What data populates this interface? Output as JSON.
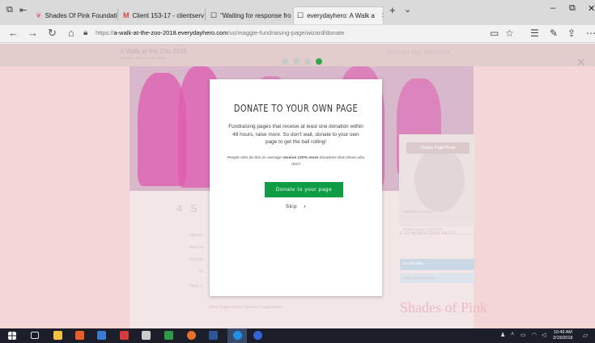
{
  "browser": {
    "tabs": [
      {
        "label": "Shades Of Pink Foundation",
        "icon": "pink-foundation-icon"
      },
      {
        "label": "Client 153-17 - clientservice",
        "icon": "gmail-icon"
      },
      {
        "label": "\"Waiting for response from",
        "icon": "page-icon"
      },
      {
        "label": "everydayhero: A Walk a",
        "icon": "page-icon",
        "active": true
      }
    ],
    "url_prefix": "https://",
    "url_domain": "a-walk-at-the-zoo-2018.everydayhero.com",
    "url_path": "/us/maggie-fundraising-page/wizard/donate"
  },
  "site": {
    "title": "A Walk at the Zoo 2018",
    "subtitle": "8 months ago • 30 Jan 2018",
    "header_links": "SEARCH    THE PATIENTS",
    "update_photo": "Update Page Photo",
    "fundraising_label": "E FUNDRAISING PAGE",
    "sidebar_rows": [
      "Support this Page",
      "Share to your Facebook",
      "Create team",
      "Invite existing team"
    ],
    "ghost_heading": "4 S",
    "ghost_lines": [
      "Upload",
      "Add exa",
      "Post an",
      "Dr",
      "Have a",
      "More Suggestions / Dismiss Suggestions"
    ],
    "logo_text": "Shades of Pink"
  },
  "wizard": {
    "steps": [
      false,
      false,
      false,
      true
    ]
  },
  "modal": {
    "title": "DONATE TO YOUR OWN PAGE",
    "body": "Fundraising pages that receive at least one donation within 48 hours, raise more. So don't wait, donate to your own page to get the ball rolling!",
    "note_pre": "People who do this on average",
    "note_bold": "receive 120% more",
    "note_post": "donations than those who don't",
    "donate_label": "Donate to your page",
    "skip_label": "Skip"
  },
  "taskbar": {
    "time": "10:49 AM",
    "date": "2/19/2018"
  },
  "colors": {
    "accent_green": "#0f9c45",
    "step_active": "#31a74a",
    "overlay_pink": "#f4d6d6"
  }
}
